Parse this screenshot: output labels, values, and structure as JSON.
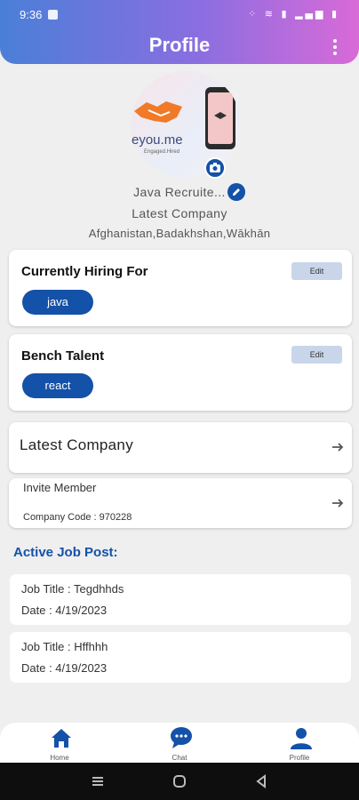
{
  "status_bar": {
    "time": "9:36",
    "icons": "⁘ ≋ ▮ ▂▄▆ ▮"
  },
  "header": {
    "title": "Profile"
  },
  "profile": {
    "logo_text": "eyou.me",
    "logo_tagline": "Engaged.Hired",
    "name": "Java Recruite...",
    "company": "Latest Company",
    "location": "Afghanistan,Badakhshan,Wākhān"
  },
  "currently_hiring": {
    "title": "Currently Hiring For",
    "edit_label": "Edit",
    "tag": "java"
  },
  "bench_talent": {
    "title": "Bench Talent",
    "edit_label": "Edit",
    "tag": "react"
  },
  "latest_company": {
    "label": "Latest Company"
  },
  "invite_member": {
    "label": "Invite Member",
    "company_code": "Company Code : 970228"
  },
  "active_jobs": {
    "heading": "Active Job Post:",
    "items": [
      {
        "title": "Job Title : Tegdhhds",
        "date": "Date : 4/19/2023"
      },
      {
        "title": "Job Title : Hffhhh",
        "date": "Date : 4/19/2023"
      }
    ]
  },
  "bottom_nav": {
    "home": "Home",
    "chat": "Chat",
    "profile": "Profile"
  },
  "colors": {
    "accent": "#1451a8",
    "header_gradient_start": "#4a7fd8",
    "header_gradient_end": "#d96ad8",
    "edit_button_bg": "#c9d6ea"
  }
}
